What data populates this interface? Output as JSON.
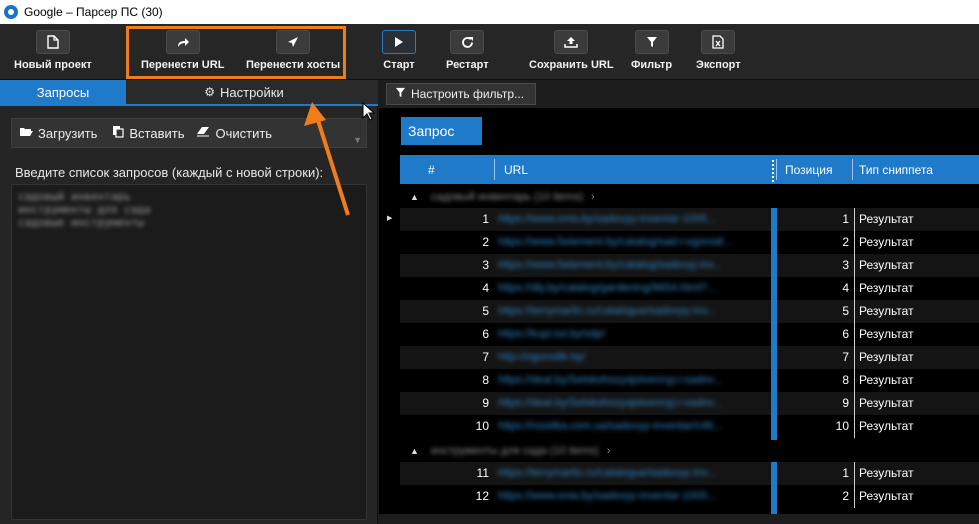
{
  "window": {
    "title": "Google – Парсер ПС (30)"
  },
  "toolbar": {
    "new_project": {
      "label": "Новый проект",
      "icon": "file-icon"
    },
    "move_url": {
      "label": "Перенести URL",
      "icon": "forward-icon"
    },
    "move_hosts": {
      "label": "Перенести хосты",
      "icon": "navigate-icon"
    },
    "start": {
      "label": "Старт",
      "icon": "play-icon"
    },
    "restart": {
      "label": "Рестарт",
      "icon": "refresh-icon"
    },
    "save_url": {
      "label": "Сохранить URL",
      "icon": "upload-icon"
    },
    "filter": {
      "label": "Фильтр",
      "icon": "filter-icon"
    },
    "export": {
      "label": "Экспорт",
      "icon": "excel-icon"
    }
  },
  "left": {
    "tabs": [
      {
        "label": "Запросы",
        "active": true
      },
      {
        "label": "Настройки",
        "active": false,
        "icon": "gear-icon"
      }
    ],
    "actions": {
      "load": "Загрузить",
      "paste": "Вставить",
      "clear": "Очистить"
    },
    "prompt": "Введите список запросов (каждый с новой строки):",
    "queries": [
      "садовый инвентарь",
      "инструменты для сада",
      "садовые инструменты"
    ]
  },
  "right": {
    "filter_button": "Настроить фильтр...",
    "group_by": "Запрос",
    "columns": [
      "#",
      "URL",
      "Позиция",
      "Тип сниппета"
    ],
    "groups": [
      {
        "title": "садовый инвентарь (10 items)",
        "rows": [
          {
            "n": "1",
            "url": "https://www.onia.by/sadovyy-inventar-1005...",
            "pos": "1",
            "type": "Результат"
          },
          {
            "n": "2",
            "url": "https://www.5element.by/catalog/sad-i-ogorod/...",
            "pos": "2",
            "type": "Результат"
          },
          {
            "n": "3",
            "url": "https://www.5element.by/catalog/sadovyj-inv...",
            "pos": "3",
            "type": "Результат"
          },
          {
            "n": "4",
            "url": "https://dly.by/catalog/gardening/9654.html?...",
            "pos": "4",
            "type": "Результат"
          },
          {
            "n": "5",
            "url": "https://terrymarlin.ru/catalogue/sadovyy-inv...",
            "pos": "5",
            "type": "Результат"
          },
          {
            "n": "6",
            "url": "https://kupi.tut.by/sdp/",
            "pos": "6",
            "type": "Результат"
          },
          {
            "n": "7",
            "url": "http://ogorodik.by/",
            "pos": "7",
            "type": "Результат"
          },
          {
            "n": "8",
            "url": "https://deal.by/Selskohozyajstvennyj-i-sadov...",
            "pos": "8",
            "type": "Результат"
          },
          {
            "n": "9",
            "url": "https://deal.by/Selskohozyajstvennyj-i-sadov...",
            "pos": "9",
            "type": "Результат"
          },
          {
            "n": "10",
            "url": "https://rozetka.com.ua/sadovyy-inventar/c46...",
            "pos": "10",
            "type": "Результат"
          }
        ]
      },
      {
        "title": "инструменты для сада (10 items)",
        "rows": [
          {
            "n": "11",
            "url": "https://terrymarlin.ru/catalogue/sadovyy-inv...",
            "pos": "1",
            "type": "Результат"
          },
          {
            "n": "12",
            "url": "https://www.onia.by/sadovyy-inventar-1005...",
            "pos": "2",
            "type": "Результат"
          }
        ]
      }
    ]
  },
  "colors": {
    "accent": "#1f7ac9",
    "highlight": "#f07d1c"
  }
}
